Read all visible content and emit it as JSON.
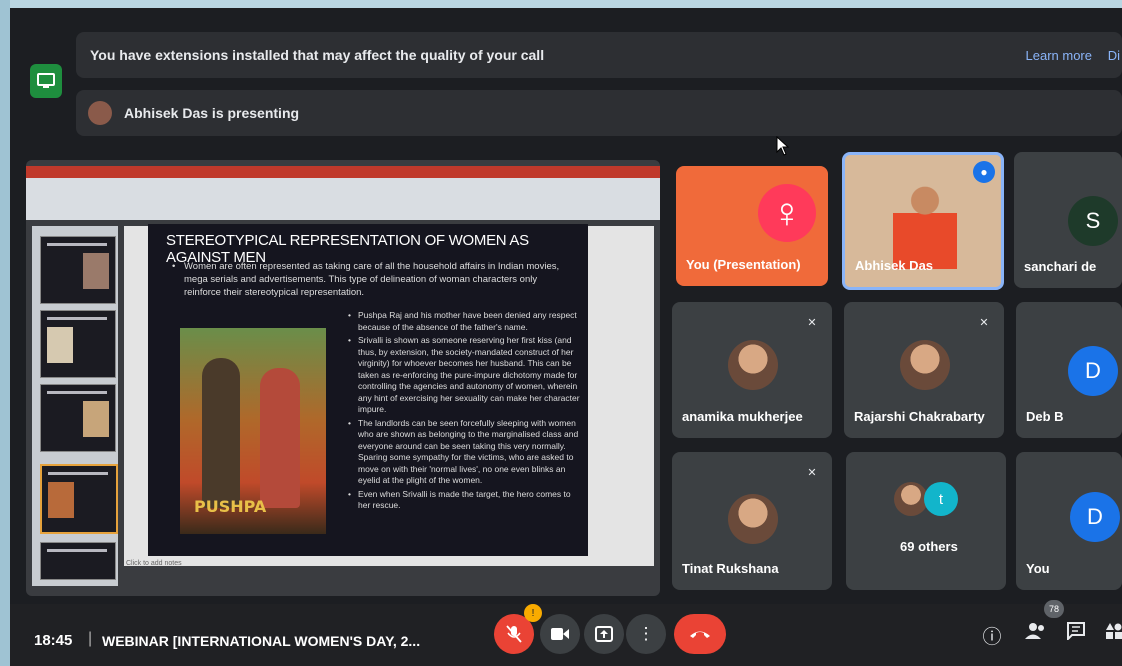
{
  "banner": {
    "extensions_text": "You have extensions installed that may affect the quality of your call",
    "learn_more": "Learn more",
    "dismiss": "Di",
    "presenting_text": "Abhisek Das is presenting"
  },
  "slide": {
    "title": "STEREOTYPICAL REPRESENTATION OF WOMEN AS AGAINST MEN",
    "bullet_main": "Women are often represented as taking care of all the household affairs in Indian movies, mega serials and advertisements. This type of delineation of woman characters only reinforce their stereotypical representation.",
    "poster_title": "PUSHPA",
    "bullets": [
      "Pushpa Raj and his mother have been denied any respect because of the absence of the father's name.",
      "Srivalli is shown as someone reserving her first kiss (and thus, by extension, the society-mandated construct of her virginity) for whoever becomes her husband. This can be taken as re-enforcing the pure-impure dichotomy made for controlling the agencies and autonomy of women, wherein any hint of exercising her sexuality can make her character impure.",
      "The landlords can be seen forcefully sleeping with women who are shown as belonging to the marginalised class and everyone around can be seen taking this very normally. Sparing some sympathy for the victims, who are asked to move on with their 'normal lives', no one even blinks an eyelid at the plight of the women.",
      "Even when Srivalli is made the target, the hero comes to her rescue."
    ],
    "notes_placeholder": "Click to add notes"
  },
  "participants": {
    "you_presentation": "You (Presentation)",
    "abhisek": "Abhisek Das",
    "sanchari": {
      "name": "sanchari de",
      "initial": "S"
    },
    "anamika": "anamika mukherjee",
    "rajarshi": "Rajarshi Chakrabarty",
    "deb": {
      "name": "Deb B",
      "initial": "D"
    },
    "tinat": "Tinat Rukshana",
    "others": {
      "label": "69 others",
      "initial": "t"
    },
    "you": {
      "name": "You",
      "initial": "D"
    }
  },
  "bottom": {
    "time": "18:45",
    "separator": "|",
    "meeting_title": "WEBINAR [INTERNATIONAL WOMEN'S DAY, 2...",
    "people_count": "78"
  },
  "colors": {
    "accent": "#8ab4f8",
    "end_call": "#ea4335",
    "ext_icon": "#1e8e3e"
  }
}
